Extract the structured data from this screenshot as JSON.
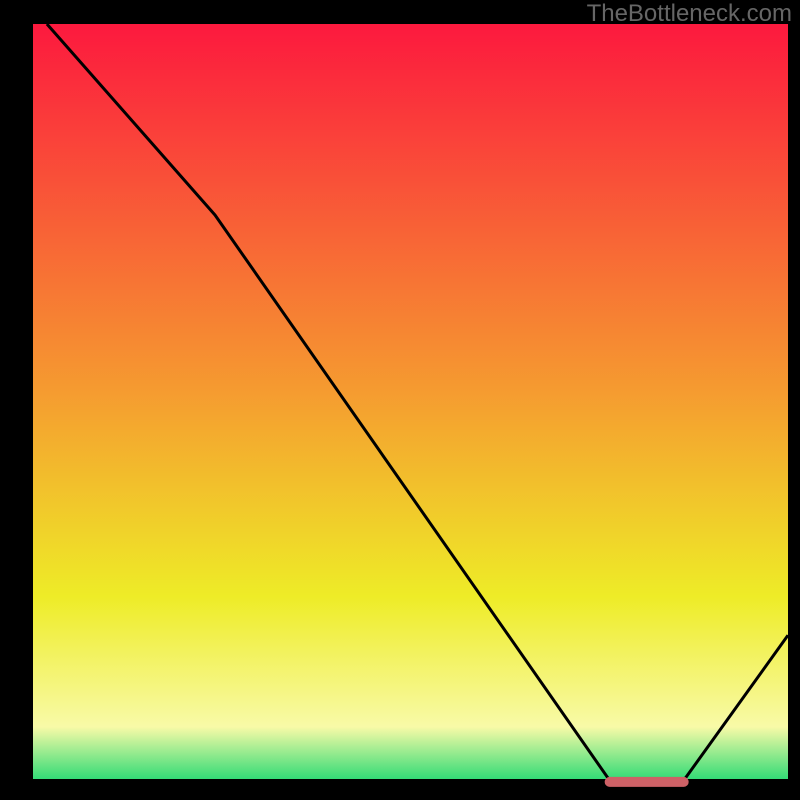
{
  "watermark": "TheBottleneck.com",
  "colors": {
    "gradient_top": "#fc193e",
    "gradient_mid1": "#f59b30",
    "gradient_mid2": "#eeec27",
    "gradient_mid3": "#f8faa7",
    "gradient_bottom": "#12d66e",
    "axis": "#000000",
    "curve": "#000000",
    "marker": "#cd6166"
  },
  "chart_data": {
    "type": "line",
    "title": "",
    "xlabel": "",
    "ylabel": "",
    "xlim": [
      0,
      100
    ],
    "ylim": [
      0,
      100
    ],
    "curve": {
      "x": [
        3,
        25,
        77,
        86,
        100
      ],
      "y": [
        100,
        75,
        0.5,
        0.5,
        20
      ]
    },
    "minimum_band": {
      "x_start": 76,
      "x_end": 87,
      "y": 0.8
    },
    "annotations": []
  }
}
